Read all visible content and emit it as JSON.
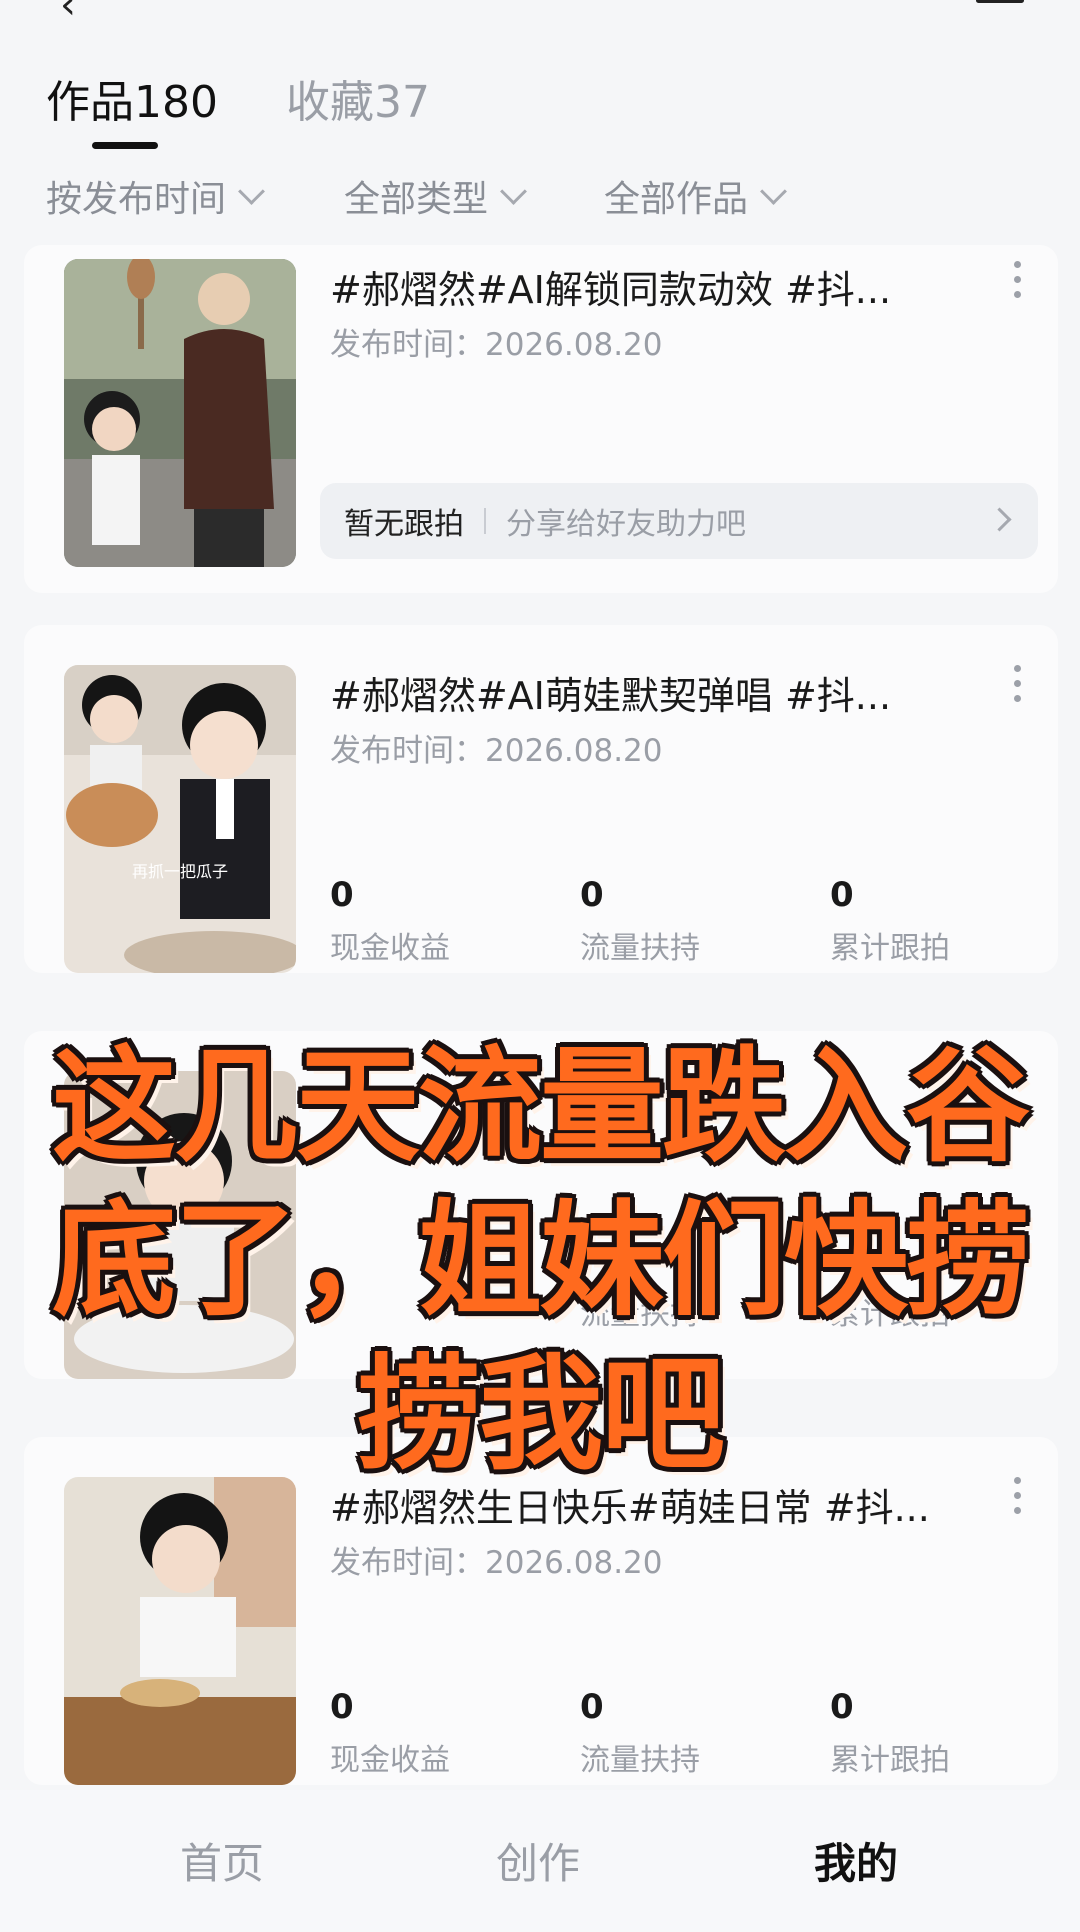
{
  "tabs": [
    {
      "label": "作品180",
      "active": true
    },
    {
      "label": "收藏37",
      "active": false
    }
  ],
  "filters": [
    {
      "label": "按发布时间"
    },
    {
      "label": "全部类型"
    },
    {
      "label": "全部作品"
    }
  ],
  "cards": [
    {
      "title": "#郝熠然#AI解锁同款动效 #抖...",
      "date": "发布时间：2026.08.20",
      "follow": {
        "left": "暂无跟拍",
        "right": "分享给好友助力吧"
      }
    },
    {
      "title": "#郝熠然#AI萌娃默契弹唱 #抖...",
      "date": "发布时间：2026.08.20",
      "thumb_caption": "再抓一把瓜子",
      "stats": [
        {
          "value": "0",
          "label": "现金收益"
        },
        {
          "value": "0",
          "label": "流量扶持"
        },
        {
          "value": "0",
          "label": "累计跟拍"
        }
      ]
    },
    {
      "title": "",
      "date": "",
      "stats": [
        {
          "value": "",
          "label": ""
        },
        {
          "value": "",
          "label": "流量扶持"
        },
        {
          "value": "",
          "label": "累计跟拍"
        }
      ]
    },
    {
      "title": "#郝熠然生日快乐#萌娃日常 #抖...",
      "date": "发布时间：2026.08.20",
      "stats": [
        {
          "value": "0",
          "label": "现金收益"
        },
        {
          "value": "0",
          "label": "流量扶持"
        },
        {
          "value": "0",
          "label": "累计跟拍"
        }
      ]
    }
  ],
  "overlay": {
    "lines": [
      "这几天流量跌入谷",
      "底了，姐妹们快捞",
      "捞我吧"
    ]
  },
  "bottom_nav": [
    {
      "label": "首页",
      "active": false
    },
    {
      "label": "创作",
      "active": false
    },
    {
      "label": "我的",
      "active": true
    }
  ],
  "colors": {
    "overlay_text": "#ff6a1e",
    "background": "#f5f6f8"
  }
}
